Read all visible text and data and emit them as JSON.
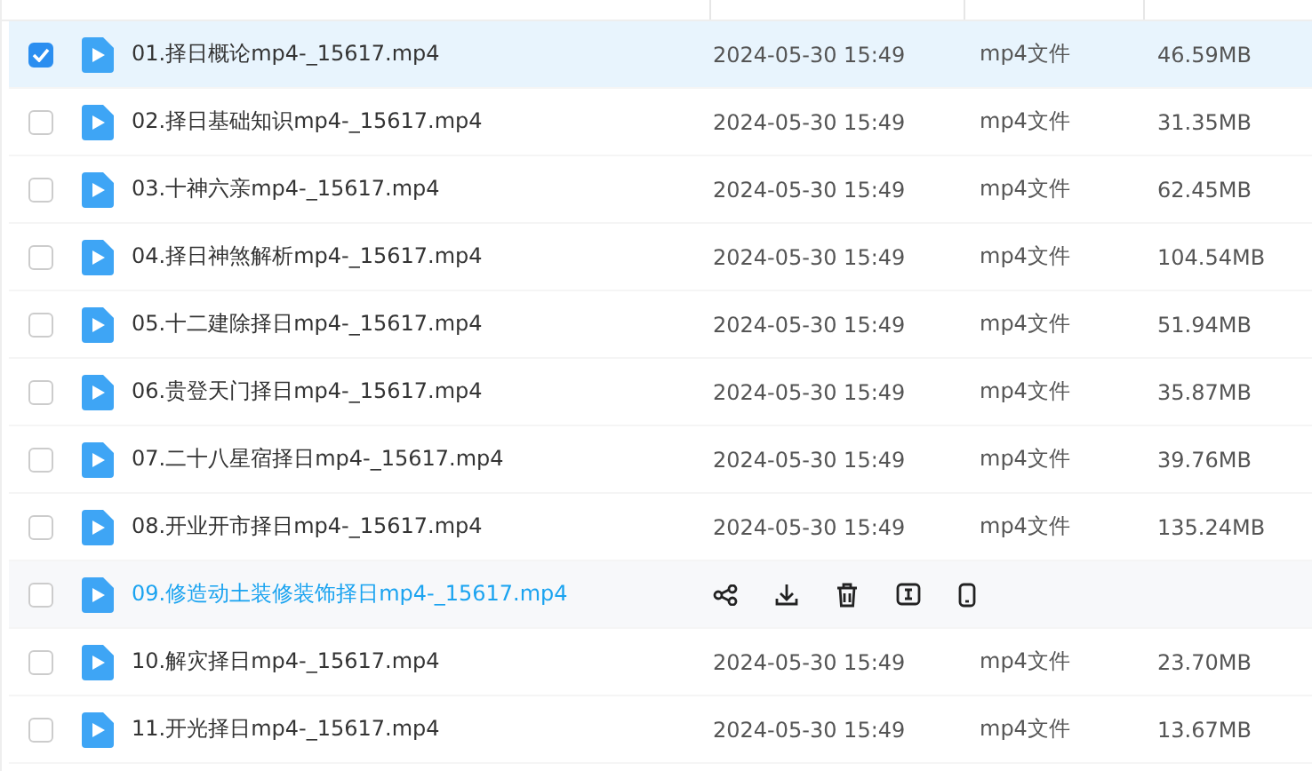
{
  "rows": [
    {
      "name": "01.择日概论mp4-_15617.mp4",
      "date": "2024-05-30 15:49",
      "type": "mp4文件",
      "size": "46.59MB",
      "selected": true,
      "hovered": false
    },
    {
      "name": "02.择日基础知识mp4-_15617.mp4",
      "date": "2024-05-30 15:49",
      "type": "mp4文件",
      "size": "31.35MB",
      "selected": false,
      "hovered": false
    },
    {
      "name": "03.十神六亲mp4-_15617.mp4",
      "date": "2024-05-30 15:49",
      "type": "mp4文件",
      "size": "62.45MB",
      "selected": false,
      "hovered": false
    },
    {
      "name": "04.择日神煞解析mp4-_15617.mp4",
      "date": "2024-05-30 15:49",
      "type": "mp4文件",
      "size": "104.54MB",
      "selected": false,
      "hovered": false
    },
    {
      "name": "05.十二建除择日mp4-_15617.mp4",
      "date": "2024-05-30 15:49",
      "type": "mp4文件",
      "size": "51.94MB",
      "selected": false,
      "hovered": false
    },
    {
      "name": "06.贵登天门择日mp4-_15617.mp4",
      "date": "2024-05-30 15:49",
      "type": "mp4文件",
      "size": "35.87MB",
      "selected": false,
      "hovered": false
    },
    {
      "name": "07.二十八星宿择日mp4-_15617.mp4",
      "date": "2024-05-30 15:49",
      "type": "mp4文件",
      "size": "39.76MB",
      "selected": false,
      "hovered": false
    },
    {
      "name": "08.开业开市择日mp4-_15617.mp4",
      "date": "2024-05-30 15:49",
      "type": "mp4文件",
      "size": "135.24MB",
      "selected": false,
      "hovered": false
    },
    {
      "name": "09.修造动土装修装饰择日mp4-_15617.mp4",
      "selected": false,
      "hovered": true
    },
    {
      "name": "10.解灾择日mp4-_15617.mp4",
      "date": "2024-05-30 15:49",
      "type": "mp4文件",
      "size": "23.70MB",
      "selected": false,
      "hovered": false
    },
    {
      "name": "11.开光择日mp4-_15617.mp4",
      "date": "2024-05-30 15:49",
      "type": "mp4文件",
      "size": "13.67MB",
      "selected": false,
      "hovered": false
    }
  ]
}
